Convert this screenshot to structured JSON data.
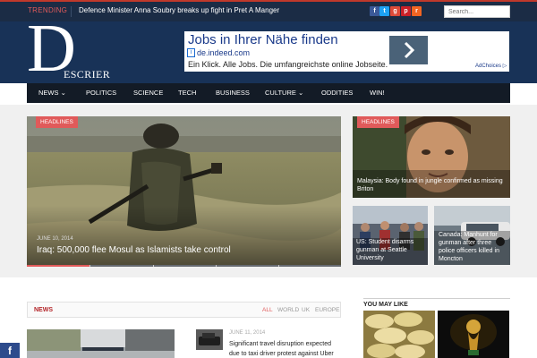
{
  "topbar": {
    "trending_label": "TRENDING",
    "trending_headline": "Defence Minister Anna Soubry breaks up fight in Pret A Manger",
    "search_placeholder": "Search...",
    "social_icons": [
      "facebook-icon",
      "twitter-icon",
      "google-plus-icon",
      "pinterest-icon",
      "rss-icon"
    ]
  },
  "logo": {
    "initial": "D",
    "rest": "ESCRIER"
  },
  "ad": {
    "title": "Jobs in Ihrer Nähe finden",
    "url": "de.indeed.com",
    "description": "Ein Klick. Alle Jobs. Die umfangreichste online Jobseite.",
    "adchoices": "AdChoices"
  },
  "nav": {
    "items": [
      {
        "label": "NEWS",
        "has_dropdown": true
      },
      {
        "label": "POLITICS",
        "has_dropdown": false
      },
      {
        "label": "SCIENCE",
        "has_dropdown": false
      },
      {
        "label": "TECH",
        "has_dropdown": false
      },
      {
        "label": "BUSINESS",
        "has_dropdown": false
      },
      {
        "label": "CULTURE",
        "has_dropdown": true
      },
      {
        "label": "ODDITIES",
        "has_dropdown": false
      },
      {
        "label": "WIN!",
        "has_dropdown": false
      }
    ]
  },
  "featured": {
    "main": {
      "tag": "HEADLINES",
      "date": "JUNE 10, 2014",
      "title": "Iraq: 500,000 flee Mosul as Islamists take control"
    },
    "side_top": {
      "tag": "HEADLINES",
      "caption": "Malaysia: Body found in jungle confirmed as missing Briton"
    },
    "side_bottom_left": {
      "caption": "US: Student disarms gunman at Seattle University"
    },
    "side_bottom_right": {
      "caption": "Canada: Manhunt for gunman after three police officers killed in Moncton"
    },
    "slider_progress": 0.2
  },
  "news": {
    "label": "NEWS",
    "filters": [
      "ALL",
      "WORLD",
      "UK",
      "EUROPE"
    ],
    "active_filter": "ALL",
    "item_date": "JUNE 11, 2014",
    "item_headline": "Significant travel disruption expected due to taxi driver protest against Uber"
  },
  "you_may_like": {
    "label": "YOU MAY LIKE"
  },
  "floating_share": {
    "icon": "facebook-icon",
    "glyph": "f"
  },
  "colors": {
    "header_bg": "#183257",
    "topbar_bg": "#1b2c45",
    "nav_bg": "#131b26",
    "accent": "#e05a5a"
  }
}
